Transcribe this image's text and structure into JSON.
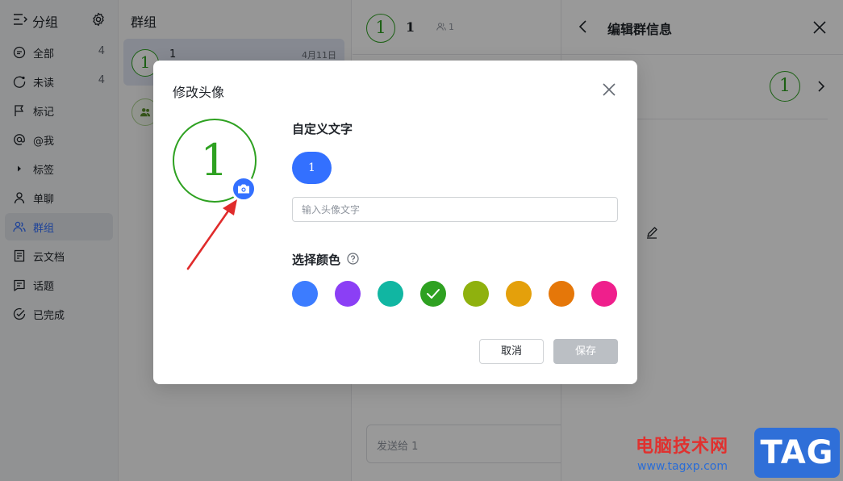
{
  "nav": {
    "title": "分组",
    "items": [
      {
        "label": "全部",
        "count": "4",
        "icon": "chat-bubble-icon"
      },
      {
        "label": "未读",
        "count": "4",
        "icon": "unread-icon"
      },
      {
        "label": "标记",
        "count": "",
        "icon": "flag-icon"
      },
      {
        "label": "@我",
        "count": "",
        "icon": "at-icon"
      },
      {
        "label": "标签",
        "count": "",
        "icon": "caret-right-icon"
      },
      {
        "label": "单聊",
        "count": "",
        "icon": "person-icon"
      },
      {
        "label": "群组",
        "count": "",
        "icon": "group-icon"
      },
      {
        "label": "云文档",
        "count": "",
        "icon": "doc-icon"
      },
      {
        "label": "话题",
        "count": "",
        "icon": "topic-icon"
      },
      {
        "label": "已完成",
        "count": "",
        "icon": "check-circle-icon"
      }
    ]
  },
  "list": {
    "title": "群组",
    "items": [
      {
        "avatar_text": "1",
        "name": "1",
        "date": "4月11日"
      }
    ]
  },
  "chat": {
    "avatar_text": "1",
    "title": "1",
    "member_count": "1",
    "input_placeholder": "发送给 1"
  },
  "right_panel": {
    "title": "编辑群信息",
    "avatar_text": "1"
  },
  "dialog": {
    "title": "修改头像",
    "avatar_text": "1",
    "custom_text_title": "自定义文字",
    "preview_text": "1",
    "input_placeholder": "输入头像文字",
    "color_title": "选择颜色",
    "colors": [
      "#3c7cff",
      "#8b3ff5",
      "#11b6a2",
      "#2ea121",
      "#8fb10e",
      "#e4a00b",
      "#e57709",
      "#ef1f8c"
    ],
    "selected_color": "#2ea121",
    "cancel_label": "取消",
    "save_label": "保存"
  },
  "watermark": {
    "cn_text": "电脑技术网",
    "url": "www.tagxp.com",
    "logo_text": "TAG"
  }
}
